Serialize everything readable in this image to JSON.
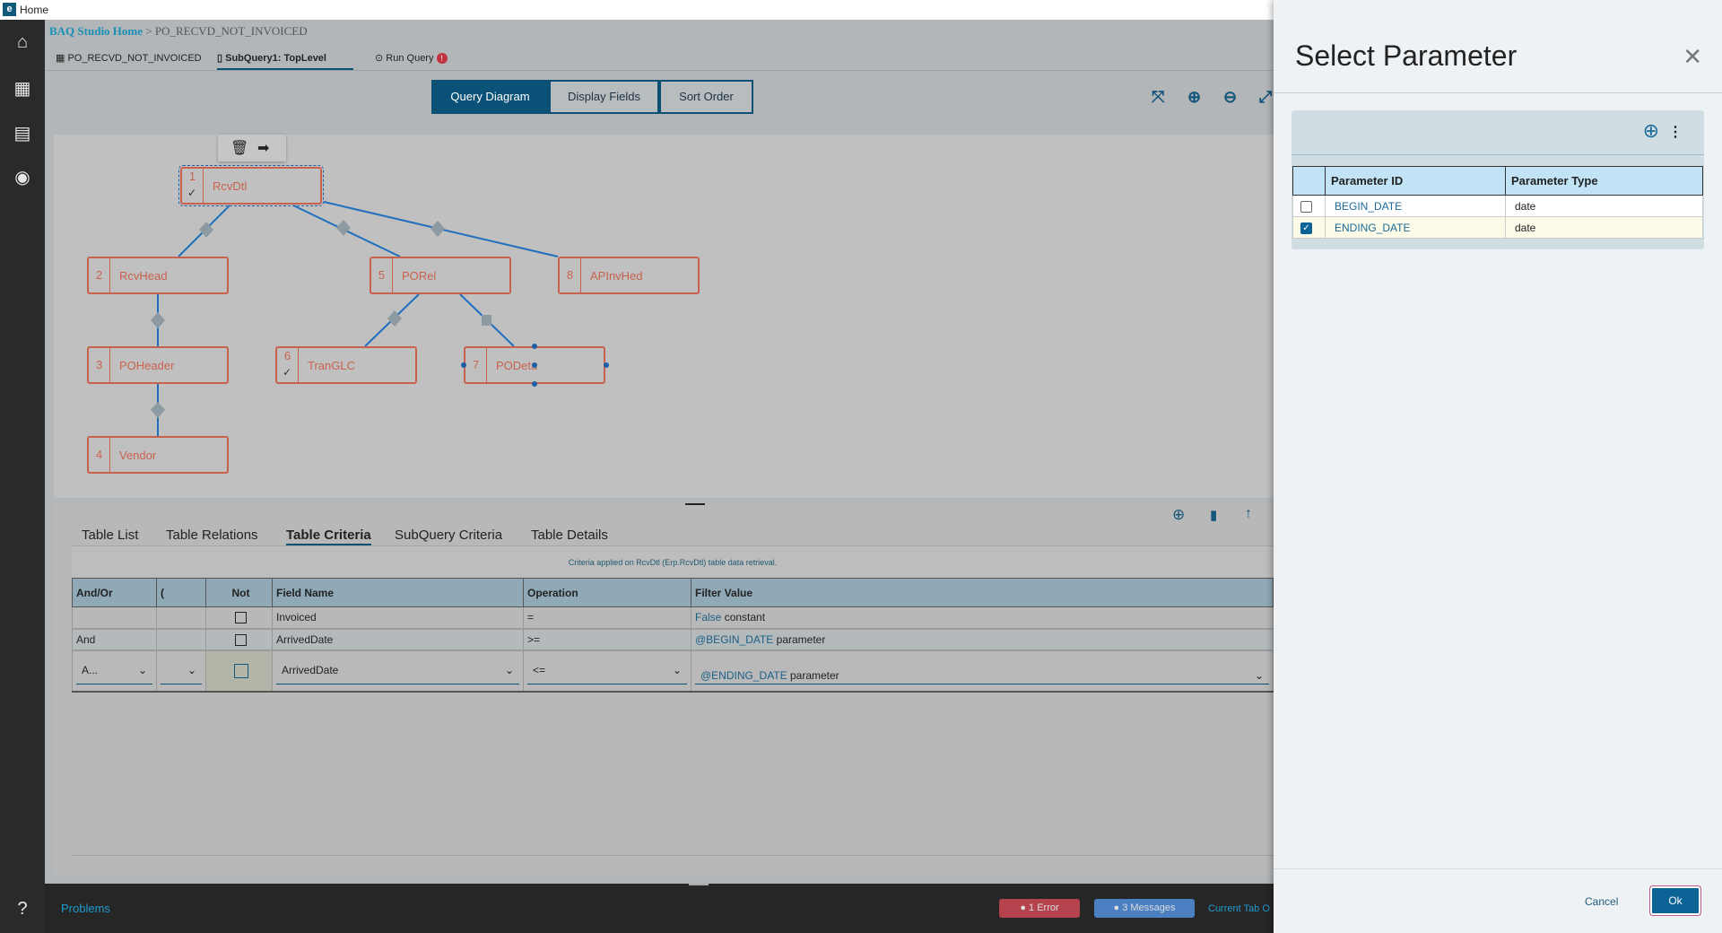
{
  "window": {
    "title": "Home",
    "min": "—",
    "restore": "❐",
    "close": "✕"
  },
  "sidebar": {
    "items": [
      "home",
      "grid",
      "document",
      "play"
    ]
  },
  "breadcrumb": {
    "home": "BAQ Studio Home",
    "sep": ">",
    "current": "PO_RECVD_NOT_INVOICED"
  },
  "query_tabs": [
    {
      "label": "PO_RECVD_NOT_INVOICED"
    },
    {
      "label": "SubQuery1: TopLevel",
      "active": true
    },
    {
      "label": "Run Query"
    }
  ],
  "view_buttons": [
    {
      "label": "Query Diagram",
      "active": true
    },
    {
      "label": "Display Fields"
    },
    {
      "label": "Sort Order"
    }
  ],
  "diagram": {
    "nodes": [
      {
        "num": "1",
        "name": "RcvDtl",
        "checked": true
      },
      {
        "num": "2",
        "name": "RcvHead"
      },
      {
        "num": "3",
        "name": "POHeader"
      },
      {
        "num": "4",
        "name": "Vendor"
      },
      {
        "num": "5",
        "name": "PORel"
      },
      {
        "num": "6",
        "name": "TranGLC",
        "checked": true
      },
      {
        "num": "7",
        "name": "PODetail"
      },
      {
        "num": "8",
        "name": "APInvHed"
      }
    ]
  },
  "lower_tabs": [
    {
      "label": "Table List"
    },
    {
      "label": "Table Relations"
    },
    {
      "label": "Table Criteria",
      "active": true
    },
    {
      "label": "SubQuery Criteria"
    },
    {
      "label": "Table Details"
    }
  ],
  "criteria": {
    "info": "Criteria applied on RcvDtl (Erp.RcvDtl) table data retrieval.",
    "headers": [
      "And/Or",
      "(",
      "Not",
      "Field Name",
      "Operation",
      "Filter Value"
    ],
    "rows": [
      {
        "andor": "",
        "paren": "",
        "field": "Invoiced",
        "op": "=",
        "value": "False",
        "value_kind": "constant"
      },
      {
        "andor": "And",
        "paren": "",
        "field": "ArrivedDate",
        "op": ">=",
        "value": "@BEGIN_DATE",
        "value_kind": "parameter"
      },
      {
        "andor": "A...",
        "paren": "",
        "field": "ArrivedDate",
        "op": "<=",
        "value": "@ENDING_DATE",
        "value_kind": "parameter"
      }
    ]
  },
  "statusbar": {
    "problems": "Problems",
    "errors": "1 Error",
    "messages": "3 Messages",
    "current_tab": "Current Tab O"
  },
  "panel": {
    "title": "Select Parameter",
    "headers": [
      "Parameter ID",
      "Parameter Type"
    ],
    "rows": [
      {
        "id": "BEGIN_DATE",
        "type": "date",
        "checked": false
      },
      {
        "id": "ENDING_DATE",
        "type": "date",
        "checked": true
      }
    ],
    "cancel": "Cancel",
    "ok": "Ok"
  },
  "colors": {
    "accent": "#0b5178",
    "node_border": "#c8624e",
    "link": "#1f6fbf",
    "error": "#b5434e",
    "info": "#4a7fc1"
  }
}
